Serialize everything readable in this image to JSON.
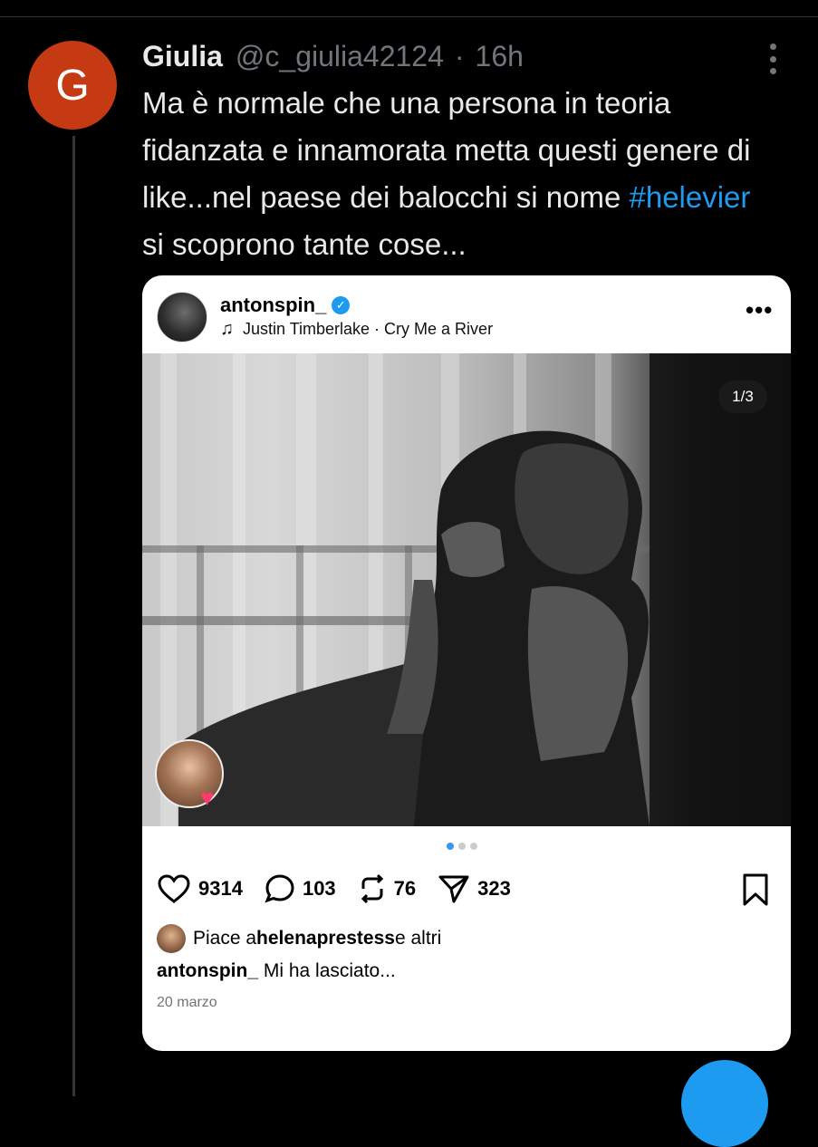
{
  "tweet": {
    "avatar_letter": "G",
    "author_name": "Giulia",
    "handle": "@c_giulia42124",
    "separator": "·",
    "time": "16h",
    "text_before": "Ma è normale che una persona in teoria fidanzata e innamorata metta questi genere di like...nel paese dei balocchi si nome ",
    "hashtag": "#helevier",
    "text_after": " si scoprono tante cose..."
  },
  "embed": {
    "username": "antonspin_",
    "verified_icon": "check-icon",
    "music_track": "Justin Timberlake · Cry Me a River",
    "more": "•••",
    "counter": "1/3",
    "likes": "9314",
    "comments": "103",
    "reposts": "76",
    "shares": "323",
    "liked_by_prefix": "Piace a ",
    "liked_by_user": "helenaprestess",
    "liked_by_suffix": " e altri",
    "caption_user": "antonspin_",
    "caption_text": " Mi ha lasciato...",
    "date": "20 marzo"
  },
  "colors": {
    "avatar": "#c53a13",
    "hashtag": "#1d9bf0",
    "accent": "#3897f0"
  }
}
